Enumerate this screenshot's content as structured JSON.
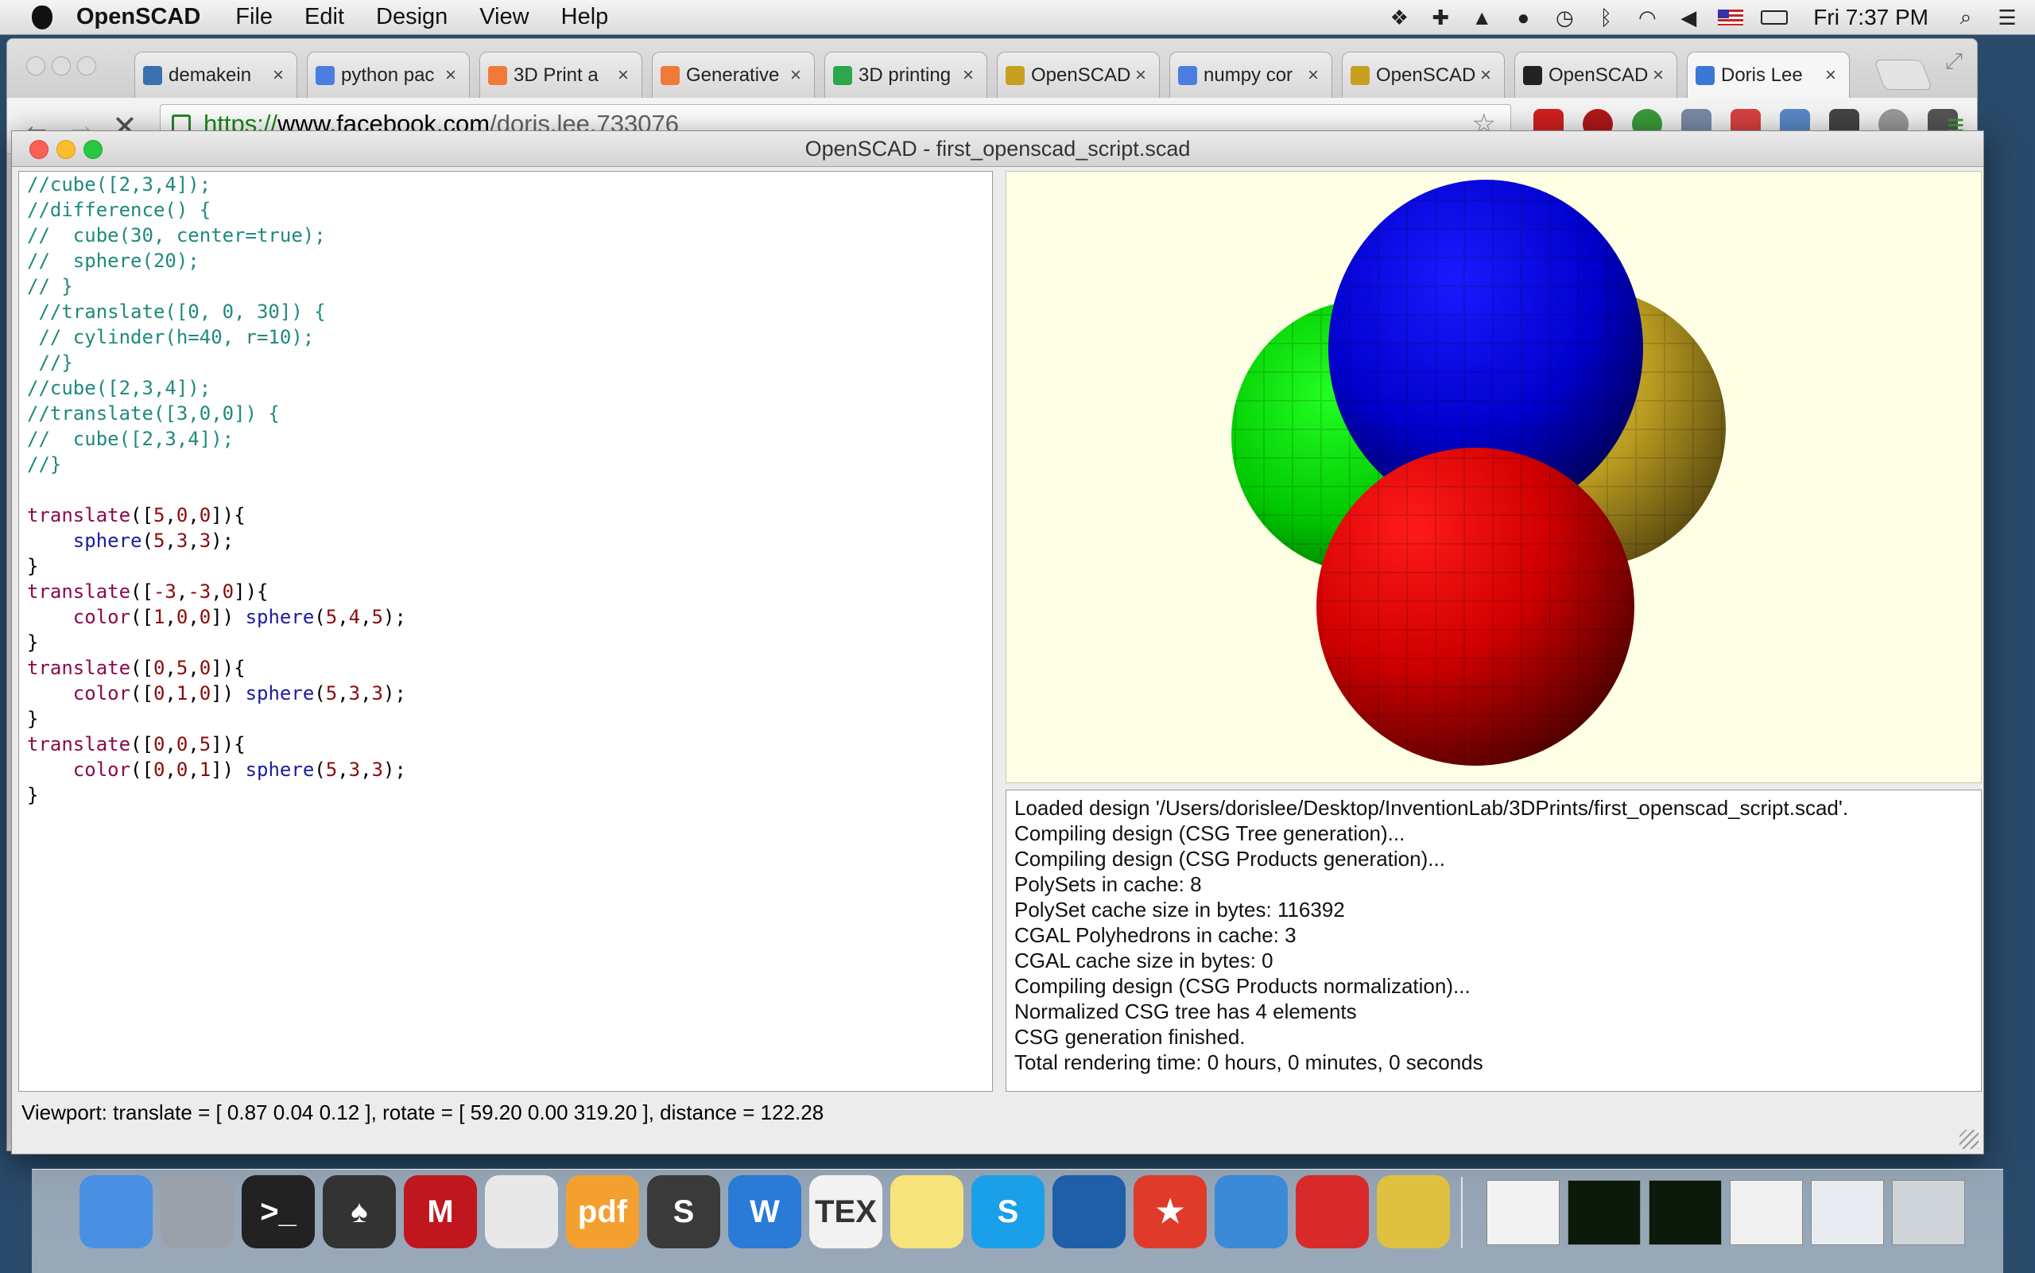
{
  "menubar": {
    "app_name": "OpenSCAD",
    "menus": [
      "File",
      "Edit",
      "Design",
      "View",
      "Help"
    ],
    "clock": "Fri 7:37 PM"
  },
  "browser": {
    "tabs": [
      {
        "label": "demakein",
        "favicon": "python-icon",
        "color": "#3a6fb0"
      },
      {
        "label": "python pac",
        "favicon": "google-icon",
        "color": "#4a7ee0"
      },
      {
        "label": "3D Print a",
        "favicon": "instructables-icon",
        "color": "#f07a3a"
      },
      {
        "label": "Generative",
        "favicon": "instructables-icon",
        "color": "#f07a3a"
      },
      {
        "label": "3D printing",
        "favicon": "globe-icon",
        "color": "#2aa84a"
      },
      {
        "label": "OpenSCAD",
        "favicon": "openscad-icon",
        "color": "#c8a020"
      },
      {
        "label": "numpy cor",
        "favicon": "google-icon",
        "color": "#4a7ee0"
      },
      {
        "label": "OpenSCAD",
        "favicon": "openscad-icon",
        "color": "#c8a020"
      },
      {
        "label": "OpenSCAD",
        "favicon": "n-icon",
        "color": "#222222"
      },
      {
        "label": "Doris Lee",
        "favicon": "loading-icon",
        "color": "#3a78d8"
      }
    ],
    "url": {
      "scheme": "https://",
      "host": "www.facebook.com",
      "path": "/doris.lee.733076"
    }
  },
  "window": {
    "title": "OpenSCAD - first_openscad_script.scad"
  },
  "editor": {
    "lines": [
      [
        {
          "t": "//cube([2,3,4]);",
          "c": "comment"
        }
      ],
      [
        {
          "t": "//difference() {",
          "c": "comment"
        }
      ],
      [
        {
          "t": "//  cube(30, center=true);",
          "c": "comment"
        }
      ],
      [
        {
          "t": "//  sphere(20);",
          "c": "comment"
        }
      ],
      [
        {
          "t": "// }",
          "c": "comment"
        }
      ],
      [
        {
          "t": " //translate([0, 0, 30]) {",
          "c": "comment"
        }
      ],
      [
        {
          "t": " // cylinder(h=40, r=10);",
          "c": "comment"
        }
      ],
      [
        {
          "t": " //}",
          "c": "comment"
        }
      ],
      [
        {
          "t": "//cube([2,3,4]);",
          "c": "comment"
        }
      ],
      [
        {
          "t": "//translate([3,0,0]) {",
          "c": "comment"
        }
      ],
      [
        {
          "t": "//  cube([2,3,4]);",
          "c": "comment"
        }
      ],
      [
        {
          "t": "//}",
          "c": "comment"
        }
      ],
      [],
      [
        {
          "t": "translate",
          "c": "kw"
        },
        {
          "t": "([",
          "c": "plain"
        },
        {
          "t": "5",
          "c": "num"
        },
        {
          "t": ",",
          "c": "plain"
        },
        {
          "t": "0",
          "c": "num"
        },
        {
          "t": ",",
          "c": "plain"
        },
        {
          "t": "0",
          "c": "num"
        },
        {
          "t": "]){",
          "c": "plain"
        }
      ],
      [
        {
          "t": "    ",
          "c": "plain"
        },
        {
          "t": "sphere",
          "c": "fn"
        },
        {
          "t": "(",
          "c": "plain"
        },
        {
          "t": "5",
          "c": "num"
        },
        {
          "t": ",",
          "c": "plain"
        },
        {
          "t": "3",
          "c": "num"
        },
        {
          "t": ",",
          "c": "plain"
        },
        {
          "t": "3",
          "c": "num"
        },
        {
          "t": ");",
          "c": "plain"
        }
      ],
      [
        {
          "t": "}",
          "c": "plain"
        }
      ],
      [
        {
          "t": "translate",
          "c": "kw"
        },
        {
          "t": "([",
          "c": "plain"
        },
        {
          "t": "-3",
          "c": "num"
        },
        {
          "t": ",",
          "c": "plain"
        },
        {
          "t": "-3",
          "c": "num"
        },
        {
          "t": ",",
          "c": "plain"
        },
        {
          "t": "0",
          "c": "num"
        },
        {
          "t": "]){",
          "c": "plain"
        }
      ],
      [
        {
          "t": "    ",
          "c": "plain"
        },
        {
          "t": "color",
          "c": "kw"
        },
        {
          "t": "([",
          "c": "plain"
        },
        {
          "t": "1",
          "c": "num"
        },
        {
          "t": ",",
          "c": "plain"
        },
        {
          "t": "0",
          "c": "num"
        },
        {
          "t": ",",
          "c": "plain"
        },
        {
          "t": "0",
          "c": "num"
        },
        {
          "t": "]) ",
          "c": "plain"
        },
        {
          "t": "sphere",
          "c": "fn"
        },
        {
          "t": "(",
          "c": "plain"
        },
        {
          "t": "5",
          "c": "num"
        },
        {
          "t": ",",
          "c": "plain"
        },
        {
          "t": "4",
          "c": "num"
        },
        {
          "t": ",",
          "c": "plain"
        },
        {
          "t": "5",
          "c": "num"
        },
        {
          "t": ");",
          "c": "plain"
        }
      ],
      [
        {
          "t": "}",
          "c": "plain"
        }
      ],
      [
        {
          "t": "translate",
          "c": "kw"
        },
        {
          "t": "([",
          "c": "plain"
        },
        {
          "t": "0",
          "c": "num"
        },
        {
          "t": ",",
          "c": "plain"
        },
        {
          "t": "5",
          "c": "num"
        },
        {
          "t": ",",
          "c": "plain"
        },
        {
          "t": "0",
          "c": "num"
        },
        {
          "t": "]){",
          "c": "plain"
        }
      ],
      [
        {
          "t": "    ",
          "c": "plain"
        },
        {
          "t": "color",
          "c": "kw"
        },
        {
          "t": "([",
          "c": "plain"
        },
        {
          "t": "0",
          "c": "num"
        },
        {
          "t": ",",
          "c": "plain"
        },
        {
          "t": "1",
          "c": "num"
        },
        {
          "t": ",",
          "c": "plain"
        },
        {
          "t": "0",
          "c": "num"
        },
        {
          "t": "]) ",
          "c": "plain"
        },
        {
          "t": "sphere",
          "c": "fn"
        },
        {
          "t": "(",
          "c": "plain"
        },
        {
          "t": "5",
          "c": "num"
        },
        {
          "t": ",",
          "c": "plain"
        },
        {
          "t": "3",
          "c": "num"
        },
        {
          "t": ",",
          "c": "plain"
        },
        {
          "t": "3",
          "c": "num"
        },
        {
          "t": ");",
          "c": "plain"
        }
      ],
      [
        {
          "t": "}",
          "c": "plain"
        }
      ],
      [
        {
          "t": "translate",
          "c": "kw"
        },
        {
          "t": "([",
          "c": "plain"
        },
        {
          "t": "0",
          "c": "num"
        },
        {
          "t": ",",
          "c": "plain"
        },
        {
          "t": "0",
          "c": "num"
        },
        {
          "t": ",",
          "c": "plain"
        },
        {
          "t": "5",
          "c": "num"
        },
        {
          "t": "]){",
          "c": "plain"
        }
      ],
      [
        {
          "t": "    ",
          "c": "plain"
        },
        {
          "t": "color",
          "c": "kw"
        },
        {
          "t": "([",
          "c": "plain"
        },
        {
          "t": "0",
          "c": "num"
        },
        {
          "t": ",",
          "c": "plain"
        },
        {
          "t": "0",
          "c": "num"
        },
        {
          "t": ",",
          "c": "plain"
        },
        {
          "t": "1",
          "c": "num"
        },
        {
          "t": "]) ",
          "c": "plain"
        },
        {
          "t": "sphere",
          "c": "fn"
        },
        {
          "t": "(",
          "c": "plain"
        },
        {
          "t": "5",
          "c": "num"
        },
        {
          "t": ",",
          "c": "plain"
        },
        {
          "t": "3",
          "c": "num"
        },
        {
          "t": ",",
          "c": "plain"
        },
        {
          "t": "3",
          "c": "num"
        },
        {
          "t": ");",
          "c": "plain"
        }
      ],
      [
        {
          "t": "}",
          "c": "plain"
        }
      ]
    ]
  },
  "viewport": {
    "background": "#ffffe6",
    "spheres": [
      {
        "name": "green-sphere",
        "color": "#00dd00"
      },
      {
        "name": "yellow-sphere",
        "color": "#d8b82a"
      },
      {
        "name": "blue-sphere",
        "color": "#0000ee"
      },
      {
        "name": "red-sphere",
        "color": "#ee0000"
      }
    ]
  },
  "console": {
    "lines": [
      "Loaded design '/Users/dorislee/Desktop/InventionLab/3DPrints/first_openscad_script.scad'.",
      "Compiling design (CSG Tree generation)...",
      "Compiling design (CSG Products generation)...",
      "PolySets in cache: 8",
      "PolySet cache size in bytes: 116392",
      "CGAL Polyhedrons in cache: 3",
      "CGAL cache size in bytes: 0",
      "Compiling design (CSG Products normalization)...",
      "Normalized CSG tree has 4 elements",
      "CSG generation finished.",
      "Total rendering time: 0 hours, 0 minutes, 0 seconds"
    ]
  },
  "statusbar": {
    "text": "Viewport: translate = [ 0.87 0.04 0.12 ], rotate = [ 59.20 0.00 319.20 ], distance = 122.28"
  },
  "dock": {
    "apps": [
      {
        "name": "finder-icon",
        "color": "#4a90e2",
        "glyph": ""
      },
      {
        "name": "launchpad-icon",
        "color": "#9aa0a8",
        "glyph": ""
      },
      {
        "name": "terminal-icon",
        "color": "#222222",
        "glyph": ">_"
      },
      {
        "name": "spade-app-icon",
        "color": "#333333",
        "glyph": "♠"
      },
      {
        "name": "mcafee-icon",
        "color": "#c0161e",
        "glyph": "M"
      },
      {
        "name": "chrome-icon",
        "color": "#e8e8e8",
        "glyph": ""
      },
      {
        "name": "pdf-app-icon",
        "color": "#f4a030",
        "glyph": "pdf"
      },
      {
        "name": "sublime-text-icon",
        "color": "#3a3a3a",
        "glyph": "S"
      },
      {
        "name": "word-icon",
        "color": "#2a7ad8",
        "glyph": "W"
      },
      {
        "name": "tex-icon",
        "color": "#f2f2f2",
        "glyph": "TEX"
      },
      {
        "name": "stickies-icon",
        "color": "#f6e47a",
        "glyph": ""
      },
      {
        "name": "skype-icon",
        "color": "#1aa0e8",
        "glyph": "S"
      },
      {
        "name": "virtualbox-icon",
        "color": "#1f5fa8",
        "glyph": ""
      },
      {
        "name": "wunderlist-icon",
        "color": "#e03a2a",
        "glyph": "★"
      },
      {
        "name": "safari-icon",
        "color": "#3a8ad8",
        "glyph": ""
      },
      {
        "name": "sketchup-icon",
        "color": "#d82a2a",
        "glyph": ""
      },
      {
        "name": "openscad-icon",
        "color": "#e0c040",
        "glyph": ""
      }
    ],
    "windows": [
      {
        "name": "minimized-window-1",
        "color": "#f2f2f2"
      },
      {
        "name": "minimized-window-2",
        "color": "#0c1a0c"
      },
      {
        "name": "minimized-window-3",
        "color": "#0c1a0c"
      },
      {
        "name": "minimized-window-4",
        "color": "#f0f0f0"
      },
      {
        "name": "minimized-window-5",
        "color": "#e8ecf0"
      },
      {
        "name": "trash-icon",
        "color": "#cfd4d8"
      }
    ]
  }
}
